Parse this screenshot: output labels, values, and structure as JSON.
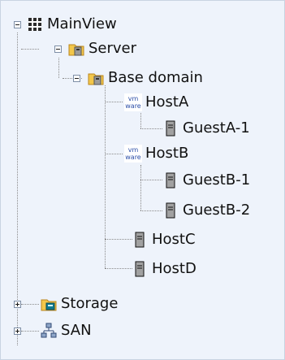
{
  "tree": {
    "root": {
      "label": "MainView",
      "icon": "grid-icon"
    },
    "server": {
      "label": "Server",
      "icon": "folder-icon"
    },
    "base_domain": {
      "label": "Base domain",
      "icon": "folder-icon"
    },
    "host_a": {
      "label": "HostA",
      "icon": "vmware-icon",
      "badge": "vm\nware"
    },
    "guest_a1": {
      "label": "GuestA-1",
      "icon": "server-icon"
    },
    "host_b": {
      "label": "HostB",
      "icon": "vmware-icon",
      "badge": "vm\nware"
    },
    "guest_b1": {
      "label": "GuestB-1",
      "icon": "server-icon"
    },
    "guest_b2": {
      "label": "GuestB-2",
      "icon": "server-icon"
    },
    "host_c": {
      "label": "HostC",
      "icon": "server-icon"
    },
    "host_d": {
      "label": "HostD",
      "icon": "server-icon"
    },
    "storage": {
      "label": "Storage",
      "icon": "folder-icon"
    },
    "san": {
      "label": "SAN",
      "icon": "network-icon"
    }
  },
  "colors": {
    "background": "#eef3fb",
    "tree_line": "#8a8a8a",
    "folder_yellow": "#f3c74a",
    "vmware_blue": "#2c4fa8"
  }
}
